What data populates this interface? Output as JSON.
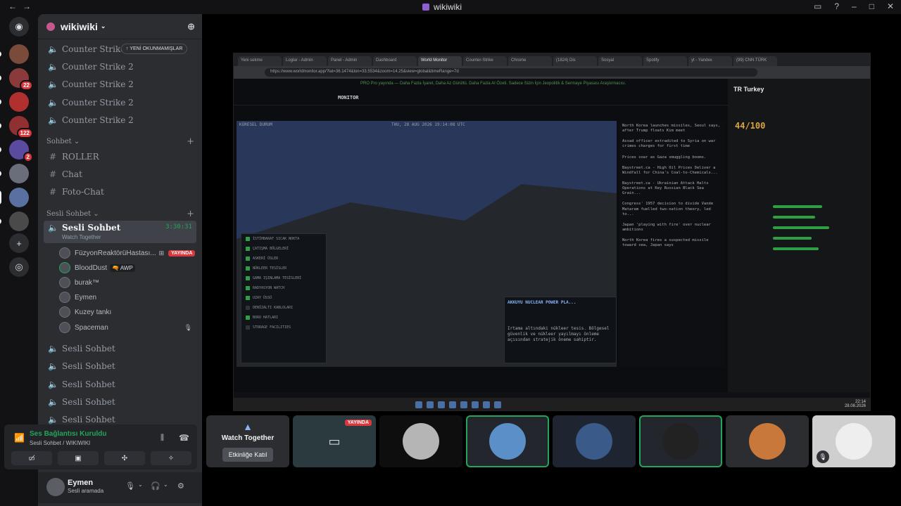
{
  "window": {
    "title": "wikiwiki"
  },
  "servers": [
    {
      "badge": ""
    },
    {
      "badge": "22"
    },
    {
      "badge": ""
    },
    {
      "badge": "122"
    },
    {
      "badge": "2"
    },
    {
      "badge": ""
    },
    {
      "badge": ""
    },
    {
      "badge": ""
    }
  ],
  "guild": {
    "name": "wikiwiki"
  },
  "unread_pill": "YENİ OKUNMAMIŞLAR",
  "voice_top": [
    "Counter Strike 2",
    "Counter Strike 2",
    "Counter Strike 2",
    "Counter Strike 2",
    "Counter Strike 2"
  ],
  "text_category": "Sohbet",
  "text_channels": [
    "ROLLER",
    "Chat",
    "Foto-Chat"
  ],
  "voice_category": "Sesli Sohbet",
  "active_voice": {
    "name": "Sesli Sohbet",
    "time": "3:30:31",
    "activity": "Watch Together"
  },
  "voice_users": [
    {
      "name": "FüzyonReaktörüHastası...",
      "tag": "",
      "live": "YAYINDA"
    },
    {
      "name": "BloodDust",
      "tag": "AWP",
      "live": ""
    },
    {
      "name": "burak™",
      "tag": "",
      "live": ""
    },
    {
      "name": "Eymen",
      "tag": "",
      "live": ""
    },
    {
      "name": "Kuzey tankı",
      "tag": "",
      "live": ""
    },
    {
      "name": "Spaceman",
      "tag": "",
      "live": ""
    }
  ],
  "voice_bottom": [
    "Sesli Sohbet",
    "Sesli Sohbet",
    "Sesli Sohbet",
    "Sesli Sohbet",
    "Sesli Sohbet"
  ],
  "connection": {
    "status": "Ses Bağlantısı Kuruldu",
    "location": "Sesli Sohbet / WIKIWIKI"
  },
  "user": {
    "name": "Eymen",
    "status": "Sesli aramada"
  },
  "stream": {
    "tabs": [
      "Yeni sekme",
      "Loglar - Admin",
      "Panel - Admin",
      "Dashboard",
      "World Monitor",
      "Counter-Strike",
      "Chrome",
      "(1824) Dis",
      "Sosyal",
      "Spotify",
      "yt - Yandex",
      "(99) CNN TÜRK"
    ],
    "url": "https://www.worldmonitor.app/?lat=36.1474&lon=33.5534&zoom=14.25&view=global&timeRange=7d",
    "banner": "PRO Pro yayında — Daha Fazla İşaret, Daha Az Gürültü. Daha Fazla AI Özeti. Sadece Sizin İçin Jeopolitik & Sermaye Piyasası Araştırmacısı.",
    "brand": "MONITOR",
    "map_header": "KÜRESEL DURUM",
    "map_date": "THU, 28 AUG 2026 19:14:08 UTC",
    "layers": [
      "İSTİHBARAT SICAK NOKTA",
      "ÇATIŞMA BÖLGELERİ",
      "ASKERİ ÜSLER",
      "NÜKLEER TESİSLER",
      "GAMA IŞINLAMA TESİSLERİ",
      "RADYASYON WATCH",
      "UZAY ÜSSÜ",
      "DENİZALTI KABLOLARI",
      "BORU HATLARI",
      "STORAGE FACILITIES"
    ],
    "popup_title": "AKKUYU NUCLEAR POWER PLA...",
    "popup_text": "Irtama altındaki nükleer tesis. Bölgesel güvenlik ve nükleer yayılmayı önleme açısından stratejik öneme sahiptir.",
    "news": [
      "North Korea launches missiles, Seoul says, after Trump floats Kim meet",
      "Assad officer extradited to Syria on war crimes charges for first time",
      "Prices soar as Gaza smuggling booms.",
      "Baystreet.ca - High Oil Prices Deliver a Windfall for China's Coal-to-Chemicals...",
      "Baystreet.ca - Ukrainian Attack Halts Operations at Key Russian Black Sea Grain...",
      "Congress' 1957 decision to divide Vande Mataram fuelled two-nation theory, led to...",
      "Japan 'playing with fire' over nuclear ambitions",
      "North Korea fires a suspected missile toward sea, Japan says"
    ],
    "country": "TR Turkey",
    "score": "44/100",
    "taskbar_time": "22:14",
    "taskbar_date": "28.08.2026"
  },
  "tiles": {
    "watch_title": "Watch Together",
    "watch_button": "Etkinliğe Katıl",
    "live": "YAYINDA"
  }
}
